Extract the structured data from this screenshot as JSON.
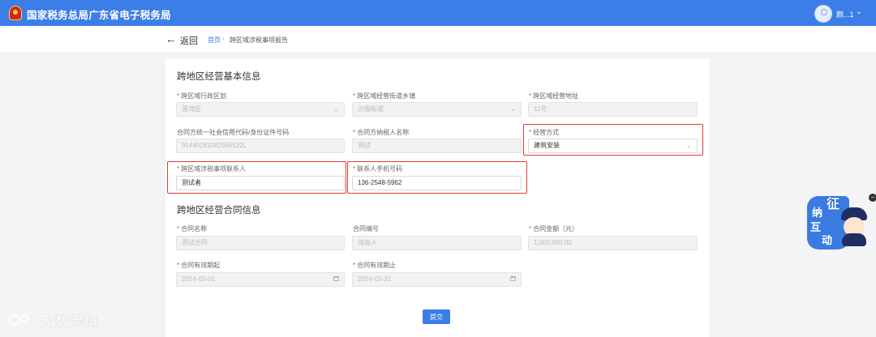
{
  "header": {
    "title": "国家税务总局广东省电子税务局",
    "user_name": "颜...1",
    "user_caret": "⌄"
  },
  "subnav": {
    "back_icon": "←",
    "back_label": "返回",
    "breadcrumb_home": "首页",
    "breadcrumb_sep": "›",
    "breadcrumb_current": "跨区域涉税事项报告"
  },
  "section1": {
    "title": "跨地区经营基本信息",
    "admin_region": {
      "label": "跨区域行政区划",
      "value": "蓬湾区",
      "required": "*"
    },
    "street_town": {
      "label": "跨区域经营街道乡镇",
      "value": "沙围街道",
      "required": "*"
    },
    "address": {
      "label": "跨区域经营地址",
      "value": "11号",
      "required": "*"
    },
    "contract_party_id": {
      "label": "合同方统一社会信用代码/身份证件号码",
      "value": "91440281082565522L"
    },
    "contract_party_name": {
      "label": "合同方纳税人名称",
      "value": "测试",
      "required": "*"
    },
    "business_mode": {
      "label": "经营方式",
      "value": "建筑安装",
      "required": "*"
    },
    "contact_person": {
      "label": "跨区域涉税事项联系人",
      "value": "测试者",
      "required": "*"
    },
    "contact_phone": {
      "label": "联系人手机号码",
      "value": "136-2548-5962",
      "required": "*"
    }
  },
  "section2": {
    "title": "跨地区经营合同信息",
    "contract_name": {
      "label": "合同名称",
      "value": "测试合同",
      "required": "*"
    },
    "contract_number": {
      "label": "合同编号",
      "placeholder": "请输入"
    },
    "contract_amount": {
      "label": "合同金额（元）",
      "value": "1,000,000.00",
      "required": "*"
    },
    "valid_from": {
      "label": "合同有效期起",
      "value": "2024-03-01",
      "required": "*"
    },
    "valid_to": {
      "label": "合同有效期止",
      "value": "2024-03-31",
      "required": "*"
    }
  },
  "submit_label": "提交",
  "mascot": {
    "chars": [
      "征",
      "纳",
      "互",
      "动"
    ],
    "close": "−"
  },
  "watermark": "大数跨境",
  "colors": {
    "primary": "#3b7ee8",
    "highlight": "#e23a3a",
    "required": "#e34d4d"
  },
  "icons": {
    "chevron": "chevron-down-icon",
    "calendar": "calendar-icon",
    "back": "arrow-left-icon"
  }
}
